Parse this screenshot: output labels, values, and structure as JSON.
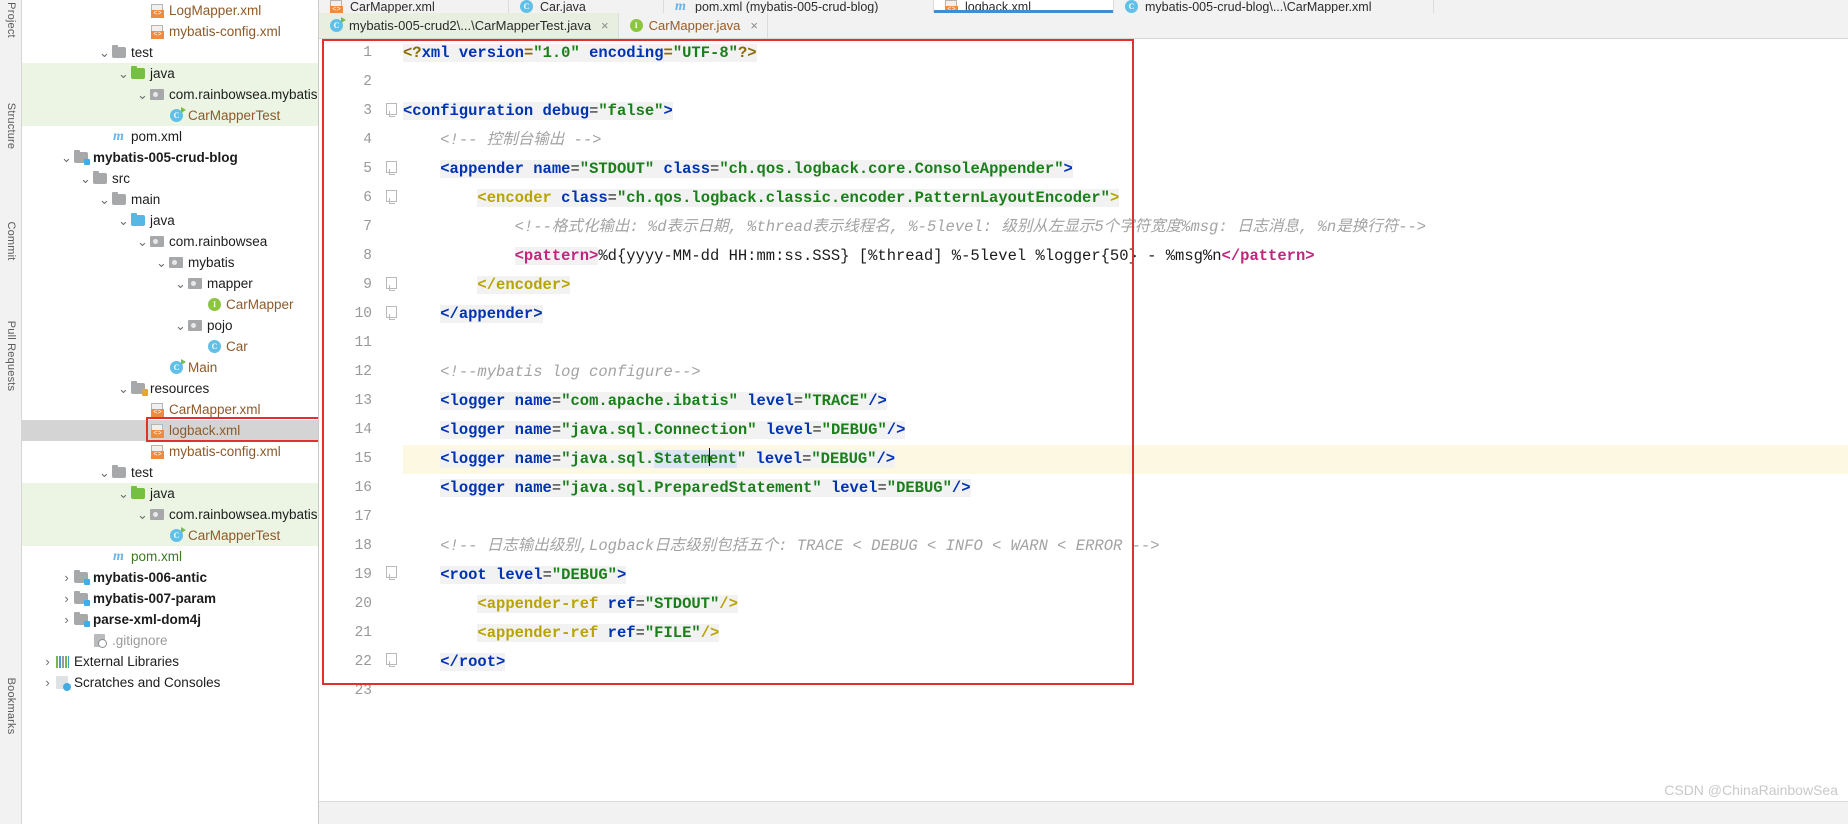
{
  "toolstrip": {
    "tabs": [
      {
        "label": "Project",
        "name": "tool-tab-project"
      },
      {
        "label": "Structure",
        "name": "tool-tab-structure"
      },
      {
        "label": "Commit",
        "name": "tool-tab-commit"
      },
      {
        "label": "Pull Requests",
        "name": "tool-tab-pull-requests"
      },
      {
        "label": "Bookmarks",
        "name": "tool-tab-bookmarks"
      }
    ]
  },
  "project_tree": {
    "items": [
      {
        "label": "LogMapper.xml",
        "indent": 6,
        "icon": "xml-file-icon",
        "arrow": "none",
        "style": "brown",
        "row": "plain"
      },
      {
        "label": "mybatis-config.xml",
        "indent": 6,
        "icon": "xml-file-icon",
        "arrow": "none",
        "style": "brown",
        "row": "plain"
      },
      {
        "label": "test",
        "indent": 4,
        "icon": "folder-gray-icon",
        "arrow": "down",
        "style": "plain",
        "row": "plain"
      },
      {
        "label": "java",
        "indent": 5,
        "icon": "folder-green-icon",
        "arrow": "down",
        "style": "plain",
        "row": "srcgreen"
      },
      {
        "label": "com.rainbowsea.mybatis.tes",
        "indent": 6,
        "icon": "package-icon",
        "arrow": "down",
        "style": "plain",
        "row": "srcgreen"
      },
      {
        "label": "CarMapperTest",
        "indent": 7,
        "icon": "class-run-icon",
        "arrow": "none",
        "style": "brown",
        "row": "srcgreen"
      },
      {
        "label": "pom.xml",
        "indent": 4,
        "icon": "maven-icon",
        "arrow": "none",
        "style": "plain",
        "row": "plain"
      },
      {
        "label": "mybatis-005-crud-blog",
        "indent": 2,
        "icon": "module-icon",
        "arrow": "down",
        "style": "bold",
        "row": "plain"
      },
      {
        "label": "src",
        "indent": 3,
        "icon": "folder-gray-icon",
        "arrow": "down",
        "style": "plain",
        "row": "plain"
      },
      {
        "label": "main",
        "indent": 4,
        "icon": "folder-gray-icon",
        "arrow": "down",
        "style": "plain",
        "row": "plain"
      },
      {
        "label": "java",
        "indent": 5,
        "icon": "folder-blue-icon",
        "arrow": "down",
        "style": "plain",
        "row": "plain"
      },
      {
        "label": "com.rainbowsea",
        "indent": 6,
        "icon": "package-icon",
        "arrow": "down",
        "style": "plain",
        "row": "plain"
      },
      {
        "label": "mybatis",
        "indent": 7,
        "icon": "package-icon",
        "arrow": "down",
        "style": "plain",
        "row": "plain"
      },
      {
        "label": "mapper",
        "indent": 8,
        "icon": "package-icon",
        "arrow": "down",
        "style": "plain",
        "row": "plain"
      },
      {
        "label": "CarMapper",
        "indent": 9,
        "icon": "interface-icon",
        "arrow": "none",
        "style": "brown",
        "row": "plain"
      },
      {
        "label": "pojo",
        "indent": 8,
        "icon": "package-icon",
        "arrow": "down",
        "style": "plain",
        "row": "plain"
      },
      {
        "label": "Car",
        "indent": 9,
        "icon": "class-icon",
        "arrow": "none",
        "style": "brown",
        "row": "plain"
      },
      {
        "label": "Main",
        "indent": 7,
        "icon": "class-run-icon",
        "arrow": "none",
        "style": "brown",
        "row": "plain"
      },
      {
        "label": "resources",
        "indent": 5,
        "icon": "resources-icon",
        "arrow": "down",
        "style": "plain",
        "row": "plain"
      },
      {
        "label": "CarMapper.xml",
        "indent": 6,
        "icon": "xml-file-icon",
        "arrow": "none",
        "style": "brown",
        "row": "plain"
      },
      {
        "label": "logback.xml",
        "indent": 6,
        "icon": "xml-file-icon",
        "arrow": "none",
        "style": "brown",
        "row": "selected"
      },
      {
        "label": "mybatis-config.xml",
        "indent": 6,
        "icon": "xml-file-icon",
        "arrow": "none",
        "style": "brown",
        "row": "plain"
      },
      {
        "label": "test",
        "indent": 4,
        "icon": "folder-gray-icon",
        "arrow": "down",
        "style": "plain",
        "row": "plain"
      },
      {
        "label": "java",
        "indent": 5,
        "icon": "folder-green-icon",
        "arrow": "down",
        "style": "plain",
        "row": "srcgreen"
      },
      {
        "label": "com.rainbowsea.mybatis.tes",
        "indent": 6,
        "icon": "package-icon",
        "arrow": "down",
        "style": "plain",
        "row": "srcgreen"
      },
      {
        "label": "CarMapperTest",
        "indent": 7,
        "icon": "class-run-icon",
        "arrow": "none",
        "style": "brown",
        "row": "srcgreen"
      },
      {
        "label": "pom.xml",
        "indent": 4,
        "icon": "maven-icon",
        "arrow": "none",
        "style": "green",
        "row": "plain"
      },
      {
        "label": "mybatis-006-antic",
        "indent": 2,
        "icon": "module-icon",
        "arrow": "right",
        "style": "bold",
        "row": "plain"
      },
      {
        "label": "mybatis-007-param",
        "indent": 2,
        "icon": "module-icon",
        "arrow": "right",
        "style": "bold",
        "row": "plain"
      },
      {
        "label": "parse-xml-dom4j",
        "indent": 2,
        "icon": "module-icon",
        "arrow": "right",
        "style": "bold",
        "row": "plain"
      },
      {
        "label": ".gitignore",
        "indent": 3,
        "icon": "gitignore-icon",
        "arrow": "none",
        "style": "gray",
        "row": "plain"
      },
      {
        "label": "External Libraries",
        "indent": 1,
        "icon": "libraries-icon",
        "arrow": "right",
        "style": "plain",
        "row": "plain"
      },
      {
        "label": "Scratches and Consoles",
        "indent": 1,
        "icon": "scratches-icon",
        "arrow": "right",
        "style": "plain",
        "row": "plain"
      }
    ]
  },
  "editor_tabs_top": [
    {
      "label": "CarMapper.xml",
      "icon": "xml-file-icon",
      "selected": false
    },
    {
      "label": "Car.java",
      "icon": "class-icon",
      "selected": false
    },
    {
      "label": "pom.xml (mybatis-005-crud-blog)",
      "icon": "maven-icon",
      "selected": false
    },
    {
      "label": "logback.xml",
      "icon": "xml-file-icon",
      "selected": true
    },
    {
      "label": "mybatis-005-crud-blog\\...\\CarMapper.xml",
      "icon": "class-icon",
      "selected": false
    }
  ],
  "editor_tabs": [
    {
      "label": "mybatis-005-crud2\\...\\CarMapperTest.java",
      "icon": "class-run-icon",
      "active": true,
      "close": "×"
    },
    {
      "label": "CarMapper.java",
      "icon": "interface-icon",
      "active": false,
      "close": "×"
    }
  ],
  "code": {
    "line_numbers": [
      "1",
      "2",
      "3",
      "4",
      "5",
      "6",
      "7",
      "8",
      "9",
      "10",
      "11",
      "12",
      "13",
      "14",
      "15",
      "16",
      "17",
      "18",
      "19",
      "20",
      "21",
      "22",
      "23"
    ],
    "lines": [
      "<?xml version=\"1.0\" encoding=\"UTF-8\"?>",
      "",
      "<configuration debug=\"false\">",
      "    <!-- 控制台输出 -->",
      "    <appender name=\"STDOUT\" class=\"ch.qos.logback.core.ConsoleAppender\">",
      "        <encoder class=\"ch.qos.logback.classic.encoder.PatternLayoutEncoder\">",
      "            <!--格式化输出: %d表示日期, %thread表示线程名, %-5level: 级别从左显示5个字符宽度%msg: 日志消息, %n是换行符-->",
      "            <pattern>%d{yyyy-MM-dd HH:mm:ss.SSS} [%thread] %-5level %logger{50} - %msg%n</pattern>",
      "        </encoder>",
      "    </appender>",
      "",
      "    <!--mybatis log configure-->",
      "    <logger name=\"com.apache.ibatis\" level=\"TRACE\"/>",
      "    <logger name=\"java.sql.Connection\" level=\"DEBUG\"/>",
      "    <logger name=\"java.sql.Statement\" level=\"DEBUG\"/>",
      "    <logger name=\"java.sql.PreparedStatement\" level=\"DEBUG\"/>",
      "",
      "    <!-- 日志输出级别,Logback日志级别包括五个: TRACE < DEBUG < INFO < WARN < ERROR -->",
      "    <root level=\"DEBUG\">",
      "        <appender-ref ref=\"STDOUT\"/>",
      "        <appender-ref ref=\"FILE\"/>",
      "    </root>",
      ""
    ],
    "cursor_line": 15,
    "selected_word": "Statement"
  },
  "watermark": "CSDN @ChinaRainbowSea",
  "colors": {
    "accent_blue": "#3d8fd4",
    "highlight_red": "#e03030",
    "source_green": "#ecf5e3",
    "cursor_line": "#fdf8e2",
    "selection_blue": "#dbe5f7"
  }
}
